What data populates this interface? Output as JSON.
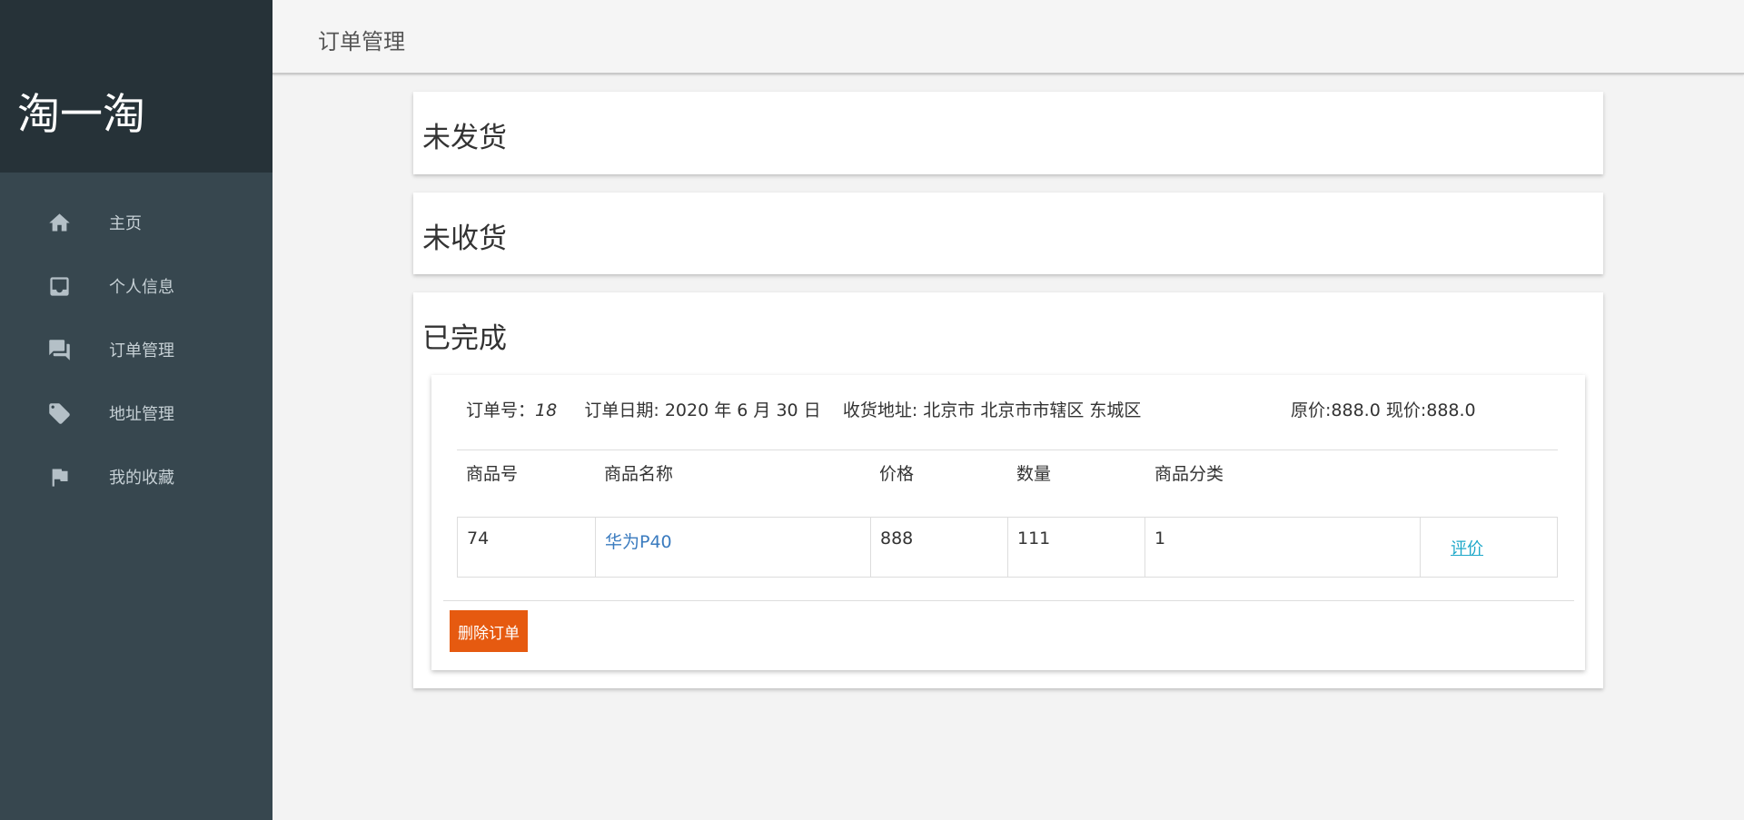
{
  "brand": {
    "title": "淘一淘"
  },
  "nav": {
    "items": [
      {
        "label": "主页",
        "icon": "home-icon"
      },
      {
        "label": "个人信息",
        "icon": "inbox-icon"
      },
      {
        "label": "订单管理",
        "icon": "chat-icon"
      },
      {
        "label": "地址管理",
        "icon": "tag-icon"
      },
      {
        "label": "我的收藏",
        "icon": "flag-icon"
      }
    ]
  },
  "header": {
    "title": "订单管理"
  },
  "sections": {
    "unshipped": {
      "title": "未发货"
    },
    "unreceived": {
      "title": "未收货"
    },
    "completed": {
      "title": "已完成"
    }
  },
  "order": {
    "id_label": "订单号：",
    "id": "18",
    "date": "订单日期: 2020 年 6 月 30 日",
    "address": "收货地址: 北京市 北京市市辖区 东城区",
    "price": "原价:888.0 现价:888.0",
    "columns": [
      "商品号",
      "商品名称",
      "价格",
      "数量",
      "商品分类"
    ],
    "rows": [
      {
        "id": "74",
        "name": "华为P40",
        "price": "888",
        "qty": "111",
        "category": "1",
        "action": "评价"
      }
    ],
    "delete_label": "删除订单"
  },
  "colors": {
    "sidebar": "#37474f",
    "brand_bg": "#263238",
    "delete_button": "#e65a10",
    "link": "#3a7bbf",
    "review_link": "#1fa8c9"
  }
}
